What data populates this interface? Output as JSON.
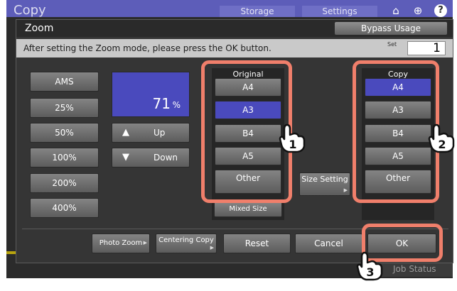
{
  "app": {
    "title": "Copy",
    "storage_label": "Storage",
    "settings_label": "Settings",
    "job_status_label": "Job Status"
  },
  "dialog": {
    "title": "Zoom",
    "bypass_label": "Bypass Usage",
    "message": "After setting the Zoom mode, please press the OK button.",
    "set_label": "Set",
    "set_value": "1"
  },
  "zoom": {
    "buttons": [
      "AMS",
      "25%",
      "50%",
      "100%",
      "200%",
      "400%"
    ],
    "value": "71",
    "unit": "%",
    "up_label": "Up",
    "down_label": "Down"
  },
  "original": {
    "label": "Original",
    "sizes": [
      "A4",
      "A3",
      "B4",
      "A5"
    ],
    "selected": "A3",
    "other_label": "Other",
    "mixed_size_label": "Mixed Size"
  },
  "copy": {
    "label": "Copy",
    "sizes": [
      "A4",
      "A3",
      "B4",
      "A5"
    ],
    "selected": "A4",
    "other_label": "Other"
  },
  "size_setting_label": "Size Setting",
  "bottom": {
    "photo_zoom_label": "Photo Zoom",
    "centering_copy_label": "Centering Copy",
    "reset_label": "Reset",
    "cancel_label": "Cancel",
    "ok_label": "OK"
  },
  "callouts": [
    "1",
    "2",
    "3"
  ],
  "colors": {
    "accent_selected": "#4a4abd",
    "highlight": "#f07f6b",
    "topbar": "#5d5db9"
  },
  "icons": [
    "home-icon",
    "globe-icon",
    "help-icon",
    "up-triangle-icon",
    "down-triangle-icon",
    "pointing-hand-icon"
  ]
}
